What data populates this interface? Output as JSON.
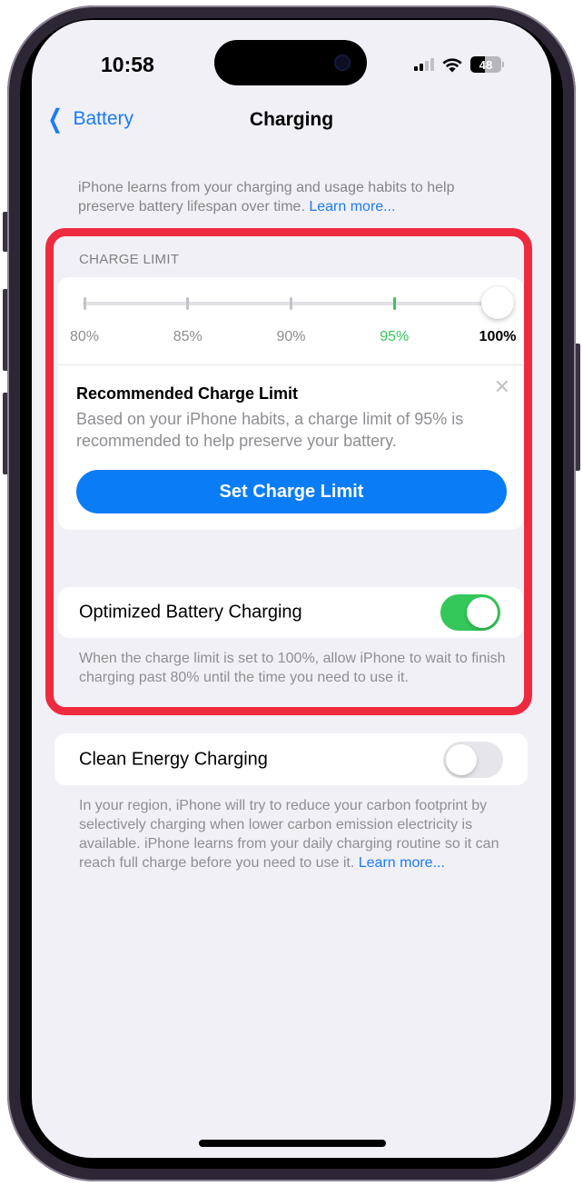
{
  "status_bar": {
    "time": "10:58",
    "battery_level": "48",
    "battery_fraction": 0.48,
    "signal_bars_active": 2,
    "signal_bars_total": 4
  },
  "nav": {
    "back_label": "Battery",
    "title": "Charging"
  },
  "intro": {
    "text": "iPhone learns from your charging and usage habits to help preserve battery lifespan over time. ",
    "link": "Learn more..."
  },
  "charge_limit": {
    "section_header": "CHARGE LIMIT",
    "slider": {
      "options": [
        "80%",
        "85%",
        "90%",
        "95%",
        "100%"
      ],
      "selected_value": "100%",
      "selected_index": 4,
      "recommended_index": 3
    },
    "recommendation": {
      "title": "Recommended Charge Limit",
      "body": "Based on your iPhone habits, a charge limit of 95% is recommended to help preserve your battery.",
      "button_label": "Set Charge Limit",
      "close_label": "✕"
    }
  },
  "optimized": {
    "label": "Optimized Battery Charging",
    "enabled": true,
    "footer": "When the charge limit is set to 100%, allow iPhone to wait to finish charging past 80% until the time you need to use it."
  },
  "clean_energy": {
    "label": "Clean Energy Charging",
    "enabled": false,
    "footer": "In your region, iPhone will try to reduce your carbon footprint by selectively charging when lower carbon emission electricity is available. iPhone learns from your daily charging routine so it can reach full charge before you need to use it. ",
    "link": "Learn more..."
  },
  "colors": {
    "accent_blue": "#0a7cf6",
    "green": "#34c759",
    "highlight_red": "#ee2a3f",
    "background": "#f1f0f6"
  }
}
